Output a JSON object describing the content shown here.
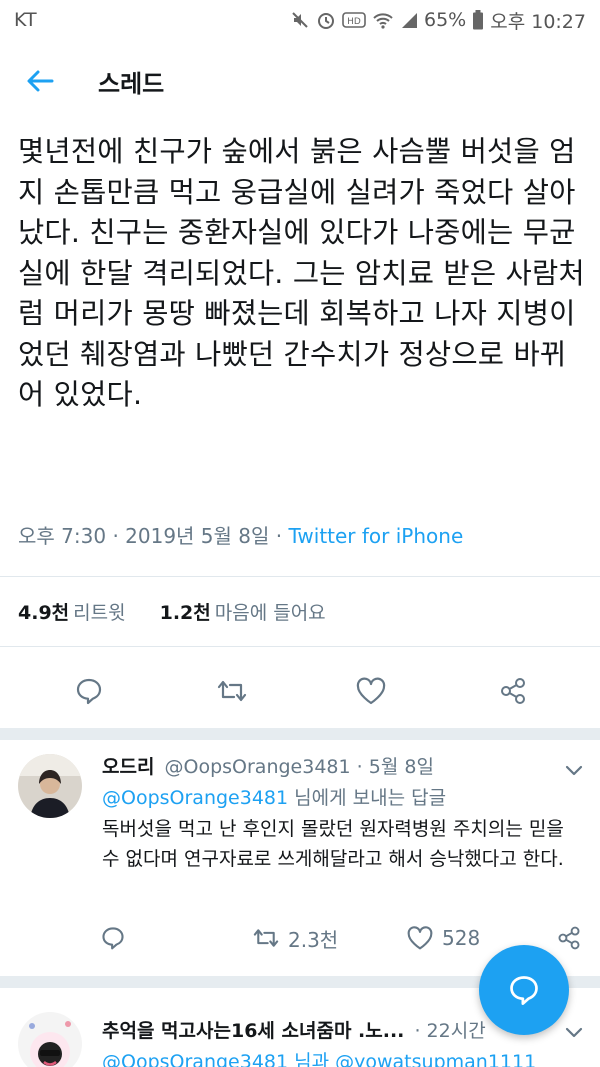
{
  "status_bar": {
    "carrier": "KT",
    "battery": "65%",
    "time": "오후 10:27",
    "icons": [
      "mute-icon",
      "alarm-icon",
      "hd-icon",
      "wifi-icon",
      "signal-icon",
      "battery-icon"
    ]
  },
  "header": {
    "title": "스레드",
    "back_icon": "arrow-left-icon"
  },
  "tweet": {
    "text": "몇년전에 친구가 숲에서 붉은 사슴뿔 버섯을 엄지 손톱만큼 먹고 웅급실에 실려가 죽었다 살아났다. 친구는 중환자실에 있다가 나중에는 무균실에 한달 격리되었다. 그는 암치료 받은 사람처럼 머리가 몽땅 빠졌는데 회복하고 나자 지병이었던 췌장염과 나빴던 간수치가 정상으로 바뀌어 있었다.",
    "time": "오후 7:30",
    "date": "2019년 5월 8일",
    "source": "Twitter for iPhone",
    "retweets_count": "4.9천",
    "retweets_label": "리트윗",
    "likes_count": "1.2천",
    "likes_label": "마음에 들어요"
  },
  "replies": [
    {
      "name": "오드리",
      "handle": "@OopsOrange3481",
      "date": "5월 8일",
      "reply_to_handle": "@OopsOrange3481",
      "reply_to_suffix": "님에게 보내는 답글",
      "text": "독버섯을 먹고 난 후인지 몰랐던 원자력병원 주치의는 믿을수 없다며 연구자료로 쓰게해달라고 해서 승낙했다고 한다.",
      "retweets": "2.3천",
      "likes": "528"
    },
    {
      "name": "추억을 먹고사는16세 소녀줌마 .노...",
      "date": "22시간",
      "reply_to_line": "@OopsOrange3481 님과 @yowatsupman1111"
    }
  ],
  "colors": {
    "accent": "#1da1f2",
    "secondary_text": "#657786",
    "divider": "#e1e8ed"
  }
}
